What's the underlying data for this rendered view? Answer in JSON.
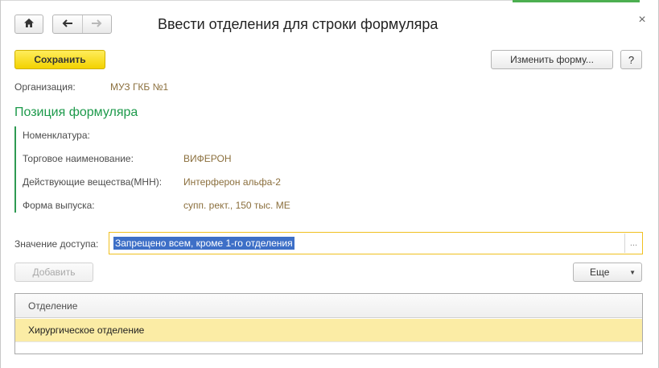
{
  "window": {
    "title": "Ввести отделения для строки формуляра",
    "close_glyph": "×",
    "accent_color": "#4caf50"
  },
  "nav": {
    "home_icon": "home-icon",
    "back_icon": "arrow-left-icon",
    "forward_icon": "arrow-right-icon"
  },
  "toolbar": {
    "save_label": "Сохранить",
    "change_form_label": "Изменить форму...",
    "help_label": "?"
  },
  "organization": {
    "label": "Организация:",
    "value": "МУЗ ГКБ №1"
  },
  "section": {
    "title": "Позиция формуляра",
    "fields": [
      {
        "label": "Номенклатура:",
        "value": ""
      },
      {
        "label": "Торговое наименование:",
        "value": "ВИФЕРОН"
      },
      {
        "label": "Действующие вещества(МНН):",
        "value": "Интерферон альфа-2"
      },
      {
        "label": "Форма выпуска:",
        "value": "супп. рект., 150 тыс. МЕ"
      }
    ]
  },
  "access": {
    "label": "Значение доступа:",
    "value": "Запрещено всем, кроме 1-го отделения",
    "pick_glyph": "..."
  },
  "table_toolbar": {
    "add_label": "Добавить",
    "more_label": "Еще",
    "more_caret": "▼"
  },
  "table": {
    "columns": [
      "Отделение"
    ],
    "rows": [
      {
        "department": "Хирургическое отделение"
      }
    ]
  }
}
